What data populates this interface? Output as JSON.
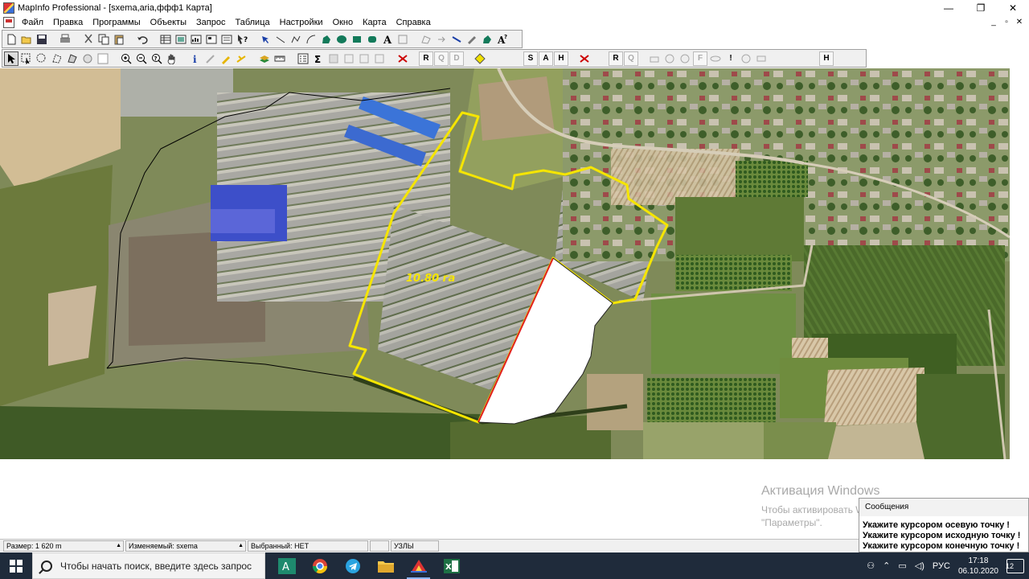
{
  "window": {
    "title": "MapInfo Professional - [sxema,aria,ффф1 Карта]",
    "controls": [
      "—",
      "❐",
      "✕"
    ],
    "mdi_controls": [
      "_",
      "▫",
      "✕"
    ]
  },
  "menu": [
    "Файл",
    "Правка",
    "Программы",
    "Объекты",
    "Запрос",
    "Таблица",
    "Настройки",
    "Окно",
    "Карта",
    "Справка"
  ],
  "toolbar2_letters": {
    "r1": "R",
    "q1": "Q",
    "d1": "D",
    "s": "S",
    "a": "A",
    "h1": "H",
    "r2": "R",
    "q2": "Q",
    "f": "F",
    "excl": "!",
    "h2": "H"
  },
  "map": {
    "area_label": "10.80  га",
    "colors": {
      "boundary": "#f5e500",
      "parcel_fill": "#ffffff",
      "parcel_edge": "#e02020"
    }
  },
  "activation": {
    "title": "Активация Windows",
    "line1": "Чтобы активировать Windows, перейдите в раздел",
    "line2": "\"Параметры\"."
  },
  "messages": {
    "title": "Сообщения",
    "lines": [
      "Укажите курсором осевую точку !",
      "Укажите курсором исходную точку !",
      "Укажите курсором конечную точку !"
    ]
  },
  "status": {
    "size": "Размер: 1 620 m",
    "editable": "Изменяемый: sxema",
    "selected": "Выбранный: НЕТ",
    "nodes": "УЗЛЫ"
  },
  "taskbar": {
    "search_placeholder": "Чтобы начать поиск, введите здесь запрос",
    "lang": "РУС",
    "time": "17:18",
    "date": "06.10.2020",
    "notification_count": "12"
  }
}
